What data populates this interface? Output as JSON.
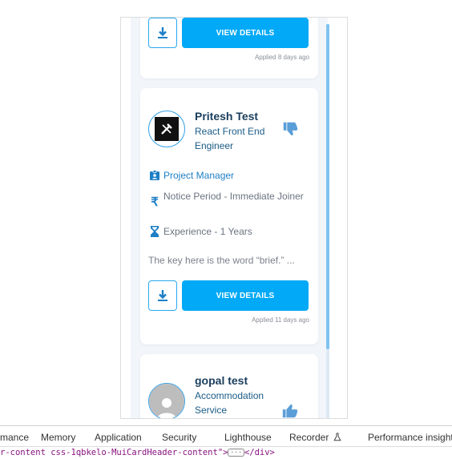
{
  "cards": [
    {
      "view_label": "VIEW DETAILS",
      "applied": "Applied 8 days ago"
    },
    {
      "name": "Pritesh Test",
      "role": "React Front End Engineer",
      "reaction": "thumbs-down-icon",
      "position": "Project Manager",
      "notice": "Notice Period - Immediate Joiner",
      "experience": "Experience - 1 Years",
      "description": "The key here is the word “brief.” ...",
      "view_label": "VIEW DETAILS",
      "applied": "Applied 11 days ago"
    },
    {
      "name": "gopal test",
      "role": "Accommodation Service",
      "reaction": "thumbs-up-icon"
    }
  ],
  "devtools": {
    "tabs": [
      "mance",
      "Memory",
      "Application",
      "Security",
      "Lighthouse",
      "Recorder",
      "Performance insights"
    ],
    "code_prefix": "r-content css-1qbkelo-MuiCardHeader-content\">",
    "code_suffix": "</div>"
  },
  "colors": {
    "primary": "#02a9f6",
    "name": "#1a3d5c",
    "role": "#1a5b86",
    "icon": "#29a8f0"
  }
}
